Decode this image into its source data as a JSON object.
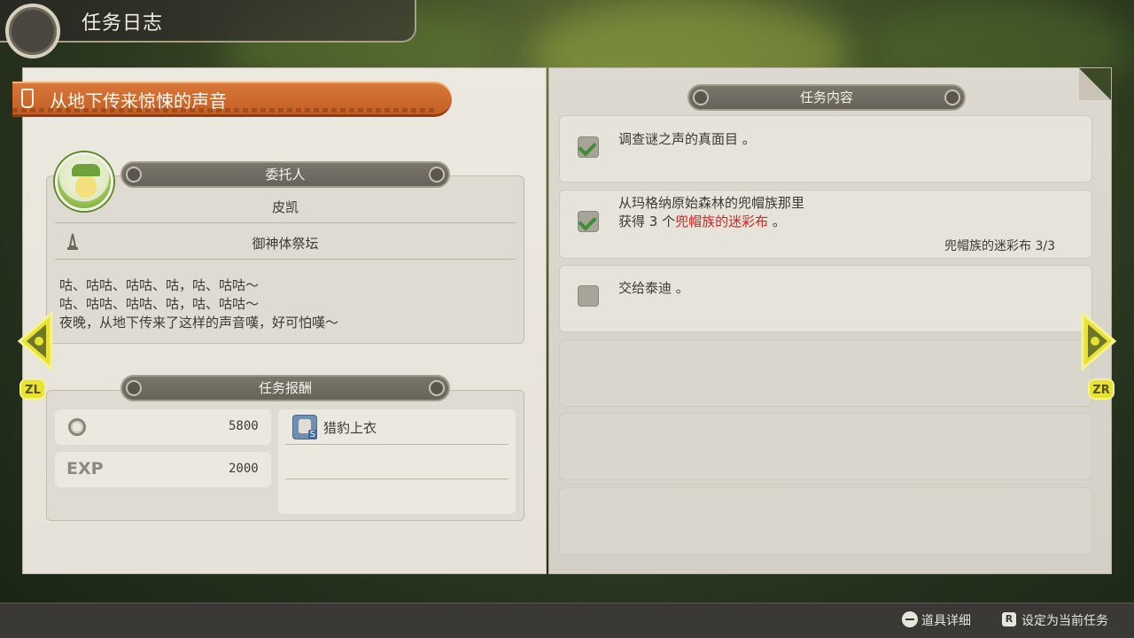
{
  "header": {
    "title": "任务日志"
  },
  "quest": {
    "title": "从地下传来惊悚的声音"
  },
  "client_section": {
    "header": "委托人",
    "name": "皮凯",
    "location": "御神体祭坛",
    "dialog": [
      "咕、咕咕、咕咕、咕，咕、咕咕～",
      "咕、咕咕、咕咕、咕，咕、咕咕～",
      "夜晚，从地下传来了这样的声音嘆，好可怕嘆～"
    ]
  },
  "reward_section": {
    "header": "任务报酬",
    "money": "5800",
    "exp_label": "EXP",
    "exp": "2000",
    "item_name": "猎豹上衣",
    "item_badge": "S"
  },
  "tasks_section": {
    "header": "任务内容",
    "tasks": [
      {
        "line1": "调查谜之声的真面目 。",
        "checked": true
      },
      {
        "line1": "从玛格纳原始森林的兜帽族那里",
        "line2_prefix": "获得 3 个",
        "line2_highlight": "兜帽族的迷彩布",
        "line2_suffix": " 。",
        "progress": "兜帽族的迷彩布  3/3",
        "checked": true
      },
      {
        "line1": "交给泰迪 。",
        "checked": false
      }
    ]
  },
  "nav": {
    "left_badge": "ZL",
    "right_badge": "ZR"
  },
  "footer": {
    "item_detail": "道具详细",
    "set_current": "设定为当前任务",
    "r_key": "R"
  },
  "colors": {
    "accent_orange": "#d9783b",
    "highlight_red": "#d3241f",
    "nav_yellow": "#e8e232",
    "check_green": "#3f8e3a"
  }
}
